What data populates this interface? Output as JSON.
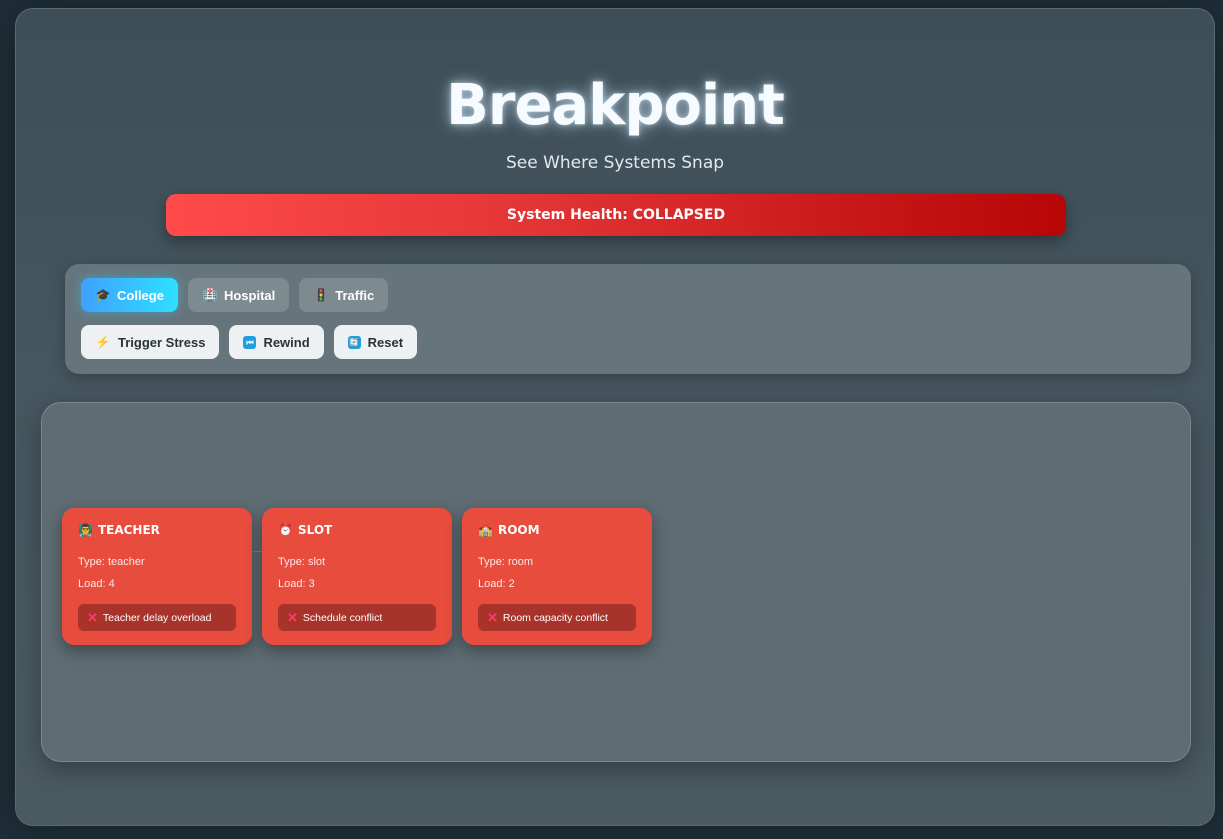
{
  "app": {
    "title": "Breakpoint",
    "subtitle": "See Where Systems Snap"
  },
  "health": {
    "label": "System Health: COLLAPSED",
    "status": "COLLAPSED",
    "color": "#e43536"
  },
  "modes": [
    {
      "icon": "🎓",
      "label": "College",
      "active": true
    },
    {
      "icon": "🏥",
      "label": "Hospital",
      "active": false
    },
    {
      "icon": "🚦",
      "label": "Traffic",
      "active": false
    }
  ],
  "actions": [
    {
      "icon": "⚡",
      "label": "Trigger Stress"
    },
    {
      "icon": "⏮",
      "label": "Rewind"
    },
    {
      "icon": "🔄",
      "label": "Reset"
    }
  ],
  "nodes": [
    {
      "icon": "👨‍🏫",
      "name": "TEACHER",
      "type": "Type: teacher",
      "load": "Load: 4",
      "error": "Teacher delay overload"
    },
    {
      "icon": "⏰",
      "name": "SLOT",
      "type": "Type: slot",
      "load": "Load: 3",
      "error": "Schedule conflict"
    },
    {
      "icon": "🏫",
      "name": "ROOM",
      "type": "Type: room",
      "load": "Load: 2",
      "error": "Room capacity conflict"
    }
  ],
  "colors": {
    "node_fail": "#e74c3c",
    "mode_active": "#2ee0ff",
    "error_mark": "#ff3b6b"
  }
}
